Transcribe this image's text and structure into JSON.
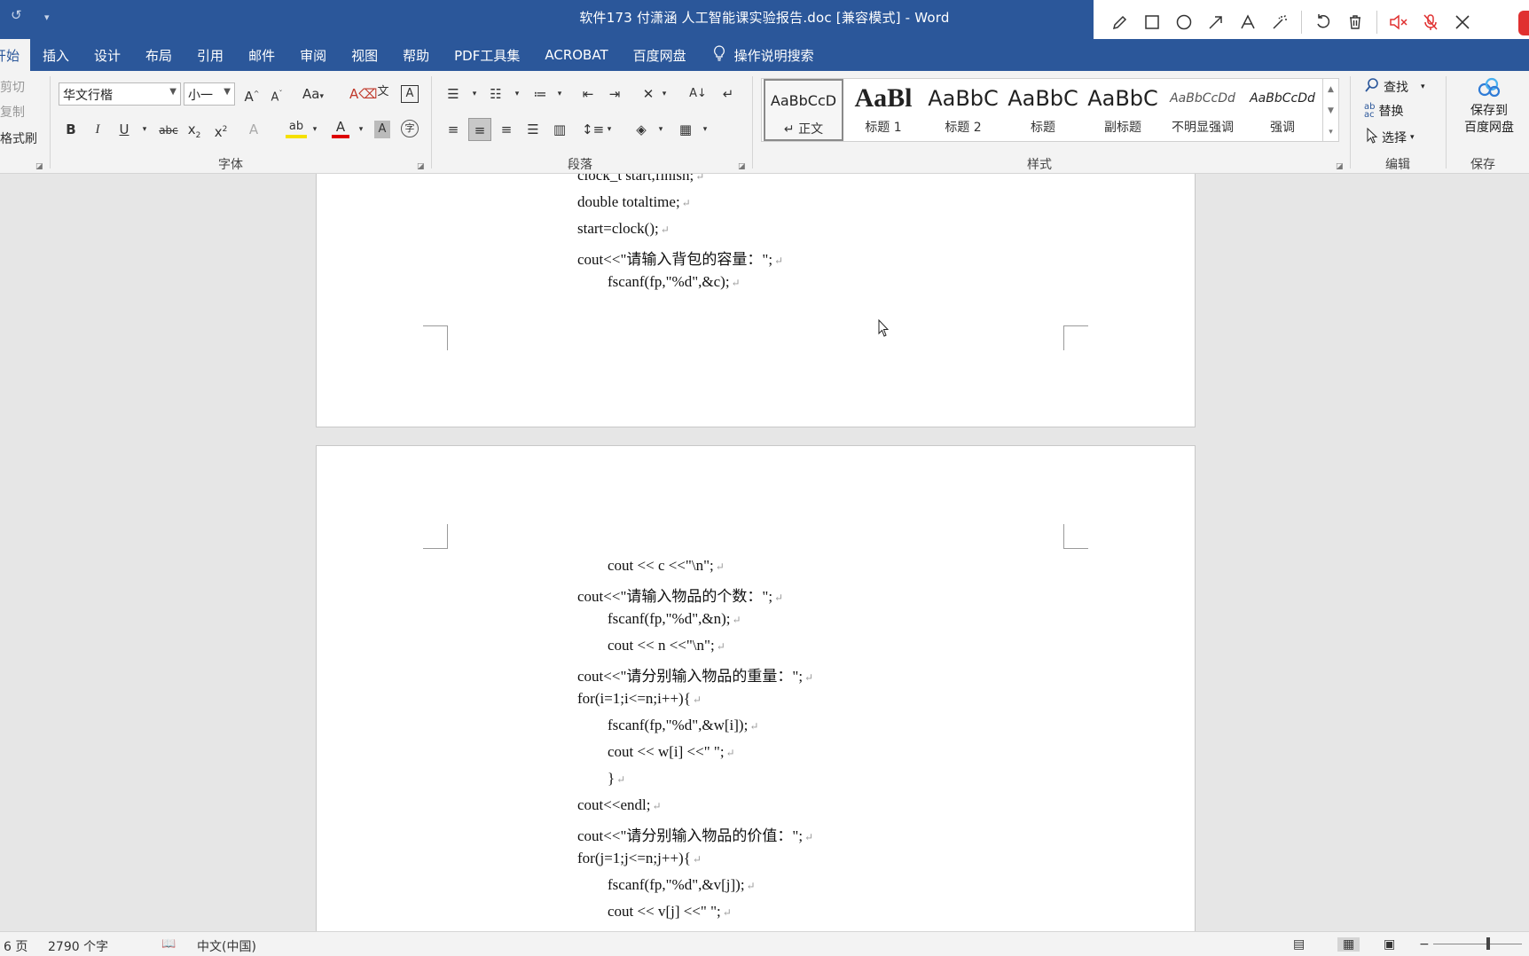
{
  "window": {
    "title": "软件173 付潇涵 人工智能课实验报告.doc [兼容模式]  -  Word"
  },
  "tabs": [
    "开始",
    "插入",
    "设计",
    "布局",
    "引用",
    "邮件",
    "审阅",
    "视图",
    "帮助",
    "PDF工具集",
    "ACROBAT",
    "百度网盘",
    "操作说明搜索"
  ],
  "clipboard": {
    "cut": "剪切",
    "copy": "复制",
    "format_painter": "格式刷"
  },
  "font": {
    "name": "华文行楷",
    "size": "小一",
    "group_label": "字体"
  },
  "paragraph": {
    "group_label": "段落"
  },
  "styles": {
    "group_label": "样式",
    "items": [
      {
        "preview": "AaBbCcD",
        "name": "↵ 正文"
      },
      {
        "preview": "AaBl",
        "name": "标题 1"
      },
      {
        "preview": "AaBbC",
        "name": "标题 2"
      },
      {
        "preview": "AaBbC",
        "name": "标题"
      },
      {
        "preview": "AaBbC",
        "name": "副标题"
      },
      {
        "preview": "AaBbCcDd",
        "name": "不明显强调"
      },
      {
        "preview": "AaBbCcDd",
        "name": "强调"
      }
    ]
  },
  "editing": {
    "group_label": "编辑",
    "find": "查找",
    "replace": "替换",
    "select": "选择"
  },
  "save": {
    "label1": "保存到",
    "label2": "百度网盘",
    "group_label": "保存"
  },
  "page1_lines": [
    "clock_t start,finish;",
    "double totaltime;",
    "start=clock();",
    "cout<<\"请输入背包的容量：\";",
    "        fscanf(fp,\"%d\",&c);"
  ],
  "page2_lines": [
    "        cout << c <<\"\\n\";",
    "cout<<\"请输入物品的个数：\";",
    "        fscanf(fp,\"%d\",&n);",
    "        cout << n <<\"\\n\";",
    "cout<<\"请分别输入物品的重量：\";",
    "for(i=1;i<=n;i++){",
    "        fscanf(fp,\"%d\",&w[i]);",
    "        cout << w[i] <<\" \";",
    "        }",
    "cout<<endl;",
    "cout<<\"请分别输入物品的价值：\";",
    "for(j=1;j<=n;j++){",
    "        fscanf(fp,\"%d\",&v[j]);",
    "        cout << v[j] <<\" \";"
  ],
  "paragraph_mark": "↵",
  "status": {
    "page": "6 页",
    "words": "2790 个字",
    "language": "中文(中国)"
  }
}
